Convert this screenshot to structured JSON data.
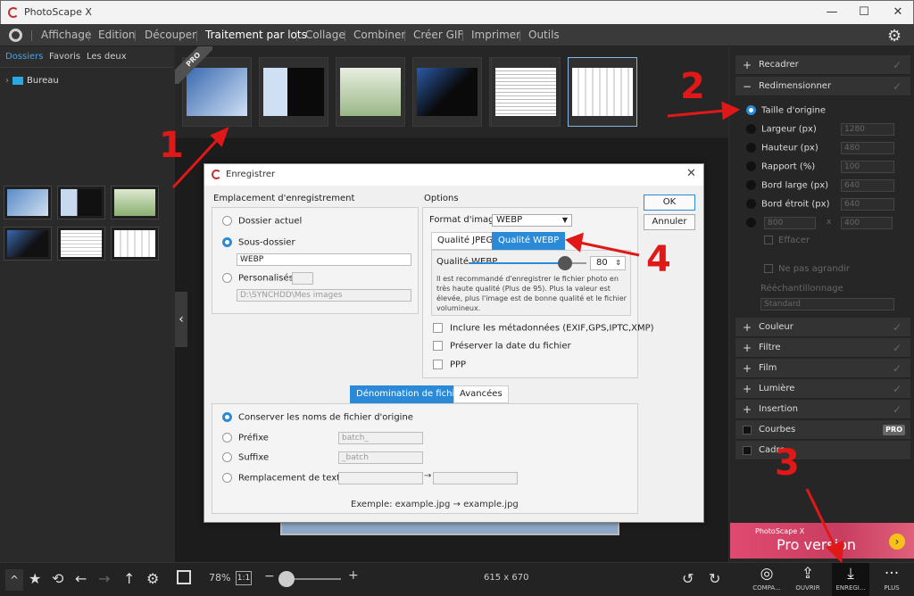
{
  "window": {
    "title": "PhotoScape X"
  },
  "menu": [
    "Affichage",
    "Edition",
    "Découper",
    "Traitement par lots",
    "Collage",
    "Combiner",
    "Créer GIF",
    "Imprimer",
    "Outils"
  ],
  "left_panel": {
    "tabs": [
      "Dossiers",
      "Favoris",
      "Les deux"
    ],
    "tree_item": "Bureau"
  },
  "strip": {
    "pro_badge": "PRO"
  },
  "right_panel": {
    "recadrer": "Recadrer",
    "redimensionner": "Redimensionner",
    "resize_options": [
      {
        "label": "Taille d'origine",
        "value": ""
      },
      {
        "label": "Largeur (px)",
        "value": "1280"
      },
      {
        "label": "Hauteur (px)",
        "value": "480"
      },
      {
        "label": "Rapport (%)",
        "value": "100"
      },
      {
        "label": "Bord large (px)",
        "value": "640"
      },
      {
        "label": "Bord étroit (px)",
        "value": "640"
      }
    ],
    "last_w": "800",
    "last_x": "x",
    "last_h": "400",
    "effacer": "Effacer",
    "ne_pas_agrandir": "Ne pas agrandir",
    "reechantillonnage": "Rééchantillonnage",
    "standard": "Standard",
    "sections": [
      "Couleur",
      "Filtre",
      "Film",
      "Lumière",
      "Insertion"
    ],
    "courbes": "Courbes",
    "cadre": "Cadre",
    "pro_badge": "PRO",
    "banner_small": "PhotoScape X",
    "banner_big": "Pro version"
  },
  "bottom": {
    "zoom": "78%",
    "ratio": "1:1",
    "image_size": "615 x 670",
    "actions": [
      "COMPA...",
      "OUVRIR",
      "ENREGI...",
      "PLUS"
    ]
  },
  "dialog": {
    "title": "Enregistrer",
    "location_title": "Emplacement d'enregistrement",
    "dossier_actuel": "Dossier actuel",
    "sous_dossier": "Sous-dossier",
    "sous_dossier_value": "WEBP",
    "personalises": "Personalisés",
    "path_value": "D:\\SYNCHDD\\Mes images",
    "options_title": "Options",
    "format_label": "Format d'image",
    "format_value": "WEBP",
    "tab_jpeg": "Qualité JPEG",
    "tab_webp": "Qualité WEBP",
    "quality_label": "Qualité WEBP",
    "quality_value": "80",
    "quality_level": 0.8,
    "quality_note_1": "Il est recommandé d'enregistrer le fichier photo en très haute qualité (Plus de 95). Plus la valeur est élevée,",
    "quality_note_2": "plus l'image est de bonne qualité et le fichier volumineux.",
    "meta": "Inclure les métadonnées (EXIF,GPS,IPTC,XMP)",
    "preserve_date": "Préserver la date du fichier",
    "ppp": "PPP",
    "ok": "OK",
    "cancel": "Annuler",
    "tab_naming": "Dénomination de fichier",
    "tab_advanced": "Avancées",
    "keep_names": "Conserver les noms de fichier d'origine",
    "prefix": "Préfixe",
    "prefix_value": "batch_",
    "suffix": "Suffixe",
    "suffix_value": "_batch",
    "replace": "Remplacement de texte",
    "replace_arrow": "→",
    "example": "Exemple: example.jpg → example.jpg"
  },
  "annotations": [
    "1",
    "2",
    "3",
    "4"
  ],
  "colors": {
    "accent": "#2a8ad8",
    "annotation": "#e01818",
    "pro_banner": "#d84468"
  }
}
